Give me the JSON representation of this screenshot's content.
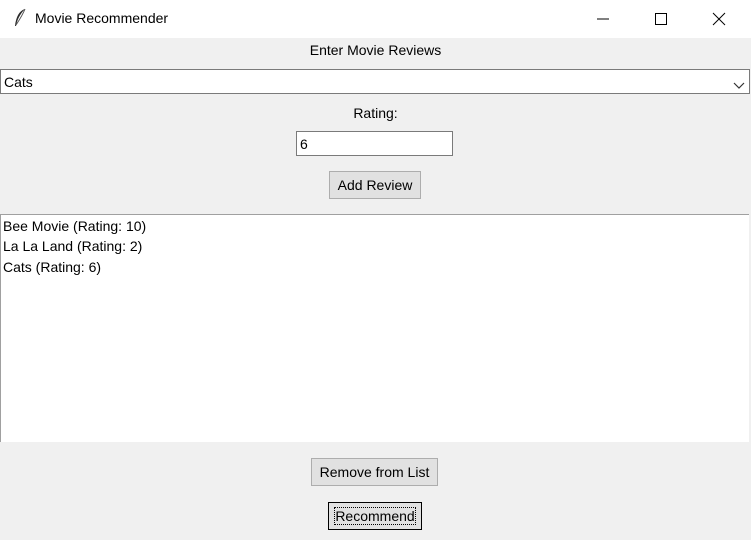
{
  "window": {
    "title": "Movie Recommender",
    "icon": "feather-icon",
    "controls": [
      "minimize-icon",
      "maximize-icon",
      "close-icon"
    ]
  },
  "form": {
    "heading": "Enter Movie Reviews",
    "movie_select_value": "Cats",
    "rating_label": "Rating:",
    "rating_value": "6",
    "add_button": "Add Review"
  },
  "reviews": {
    "items": [
      "Bee Movie (Rating: 10)",
      "La La Land (Rating: 2)",
      "Cats (Rating: 6)"
    ]
  },
  "actions": {
    "remove_button": "Remove from List",
    "recommend_button": "Recommend"
  }
}
